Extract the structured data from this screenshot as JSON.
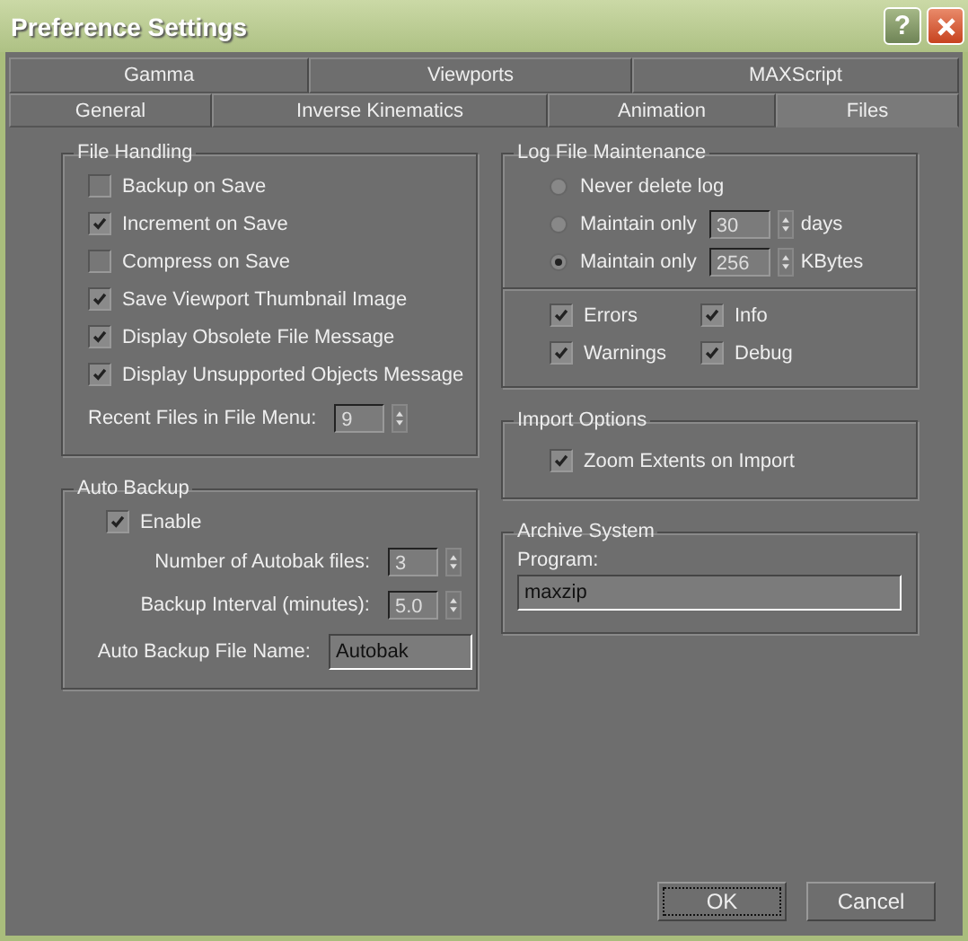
{
  "window": {
    "title": "Preference Settings",
    "help_button": "?"
  },
  "tab_rows": [
    {
      "tabs": [
        {
          "label": "Gamma",
          "selected": false
        },
        {
          "label": "Viewports",
          "selected": false
        },
        {
          "label": "MAXScript",
          "selected": false
        }
      ]
    },
    {
      "tabs": [
        {
          "label": "General",
          "selected": false
        },
        {
          "label": "Inverse Kinematics",
          "selected": false
        },
        {
          "label": "Animation",
          "selected": false
        },
        {
          "label": "Files",
          "selected": true
        }
      ]
    }
  ],
  "file_handling": {
    "title": "File Handling",
    "options": [
      {
        "label": "Backup on Save",
        "checked": false
      },
      {
        "label": "Increment on Save",
        "checked": true
      },
      {
        "label": "Compress on Save",
        "checked": false
      },
      {
        "label": "Save Viewport Thumbnail Image",
        "checked": true
      },
      {
        "label": "Display Obsolete File Message",
        "checked": true
      },
      {
        "label": "Display Unsupported Objects Message",
        "checked": true
      }
    ],
    "recent_files": {
      "label": "Recent Files in File Menu:",
      "value": "9"
    }
  },
  "auto_backup": {
    "title": "Auto Backup",
    "enable": {
      "label": "Enable",
      "checked": true
    },
    "fields": [
      {
        "kind": "spinner",
        "label": "Number of Autobak files:",
        "value": "3"
      },
      {
        "kind": "spinner",
        "label": "Backup Interval (minutes):",
        "value": "5.0"
      },
      {
        "kind": "text",
        "label": "Auto Backup File Name:",
        "value": "Autobak"
      }
    ]
  },
  "log_file": {
    "title": "Log File Maintenance",
    "radios": [
      {
        "label": "Never delete log",
        "selected": false
      },
      {
        "label": "Maintain only",
        "selected": false,
        "value": "30",
        "unit": "days"
      },
      {
        "label": "Maintain only",
        "selected": true,
        "value": "256",
        "unit": "KBytes"
      }
    ],
    "checks": [
      {
        "label": "Errors",
        "checked": true
      },
      {
        "label": "Info",
        "checked": true
      },
      {
        "label": "Warnings",
        "checked": true
      },
      {
        "label": "Debug",
        "checked": true
      }
    ]
  },
  "import_options": {
    "title": "Import Options",
    "options": [
      {
        "label": "Zoom Extents on Import",
        "checked": true
      }
    ]
  },
  "archive_system": {
    "title": "Archive System",
    "label": "Program:",
    "value": "maxzip"
  },
  "buttons": [
    {
      "label": "OK",
      "focused": true
    },
    {
      "label": "Cancel",
      "focused": false
    }
  ]
}
